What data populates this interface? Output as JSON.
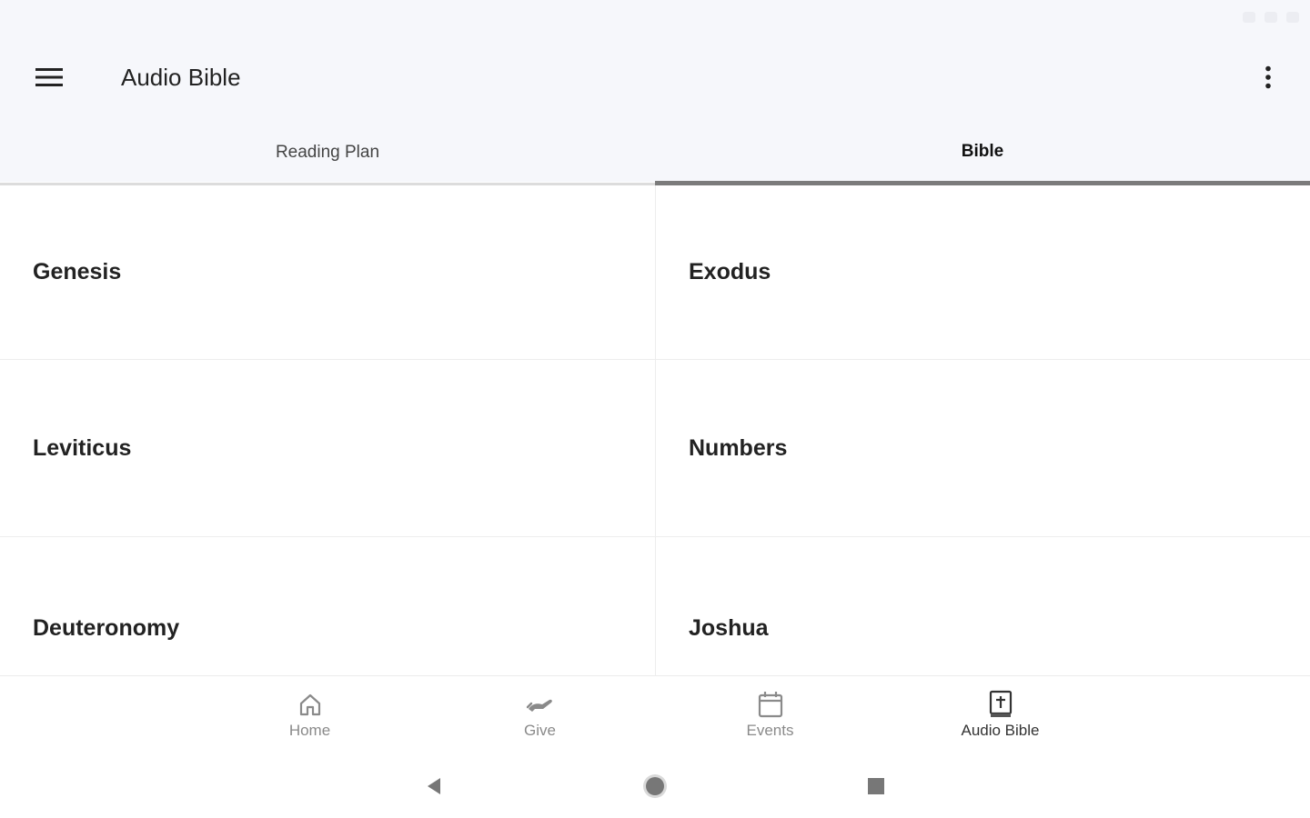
{
  "app_bar": {
    "title": "Audio Bible",
    "menu_icon": "hamburger-menu-icon",
    "overflow_icon": "more-vert-icon"
  },
  "tabs": [
    {
      "label": "Reading Plan",
      "active": false
    },
    {
      "label": "Bible",
      "active": true
    }
  ],
  "books": [
    "Genesis",
    "Exodus",
    "Leviticus",
    "Numbers",
    "Deuteronomy",
    "Joshua"
  ],
  "bottom_nav": [
    {
      "label": "Home",
      "icon": "home-icon",
      "active": false
    },
    {
      "label": "Give",
      "icon": "give-hand-icon",
      "active": false
    },
    {
      "label": "Events",
      "icon": "calendar-icon",
      "active": false
    },
    {
      "label": "Audio Bible",
      "icon": "bible-icon",
      "active": true
    }
  ],
  "system_nav": {
    "back_icon": "back-triangle-icon",
    "home_icon": "home-circle-icon",
    "recents_icon": "recents-square-icon"
  },
  "colors": {
    "app_bar_bg": "#f6f7fb",
    "tab_indicator": "#7b7b7b",
    "inactive_nav": "#8a8a8a"
  }
}
